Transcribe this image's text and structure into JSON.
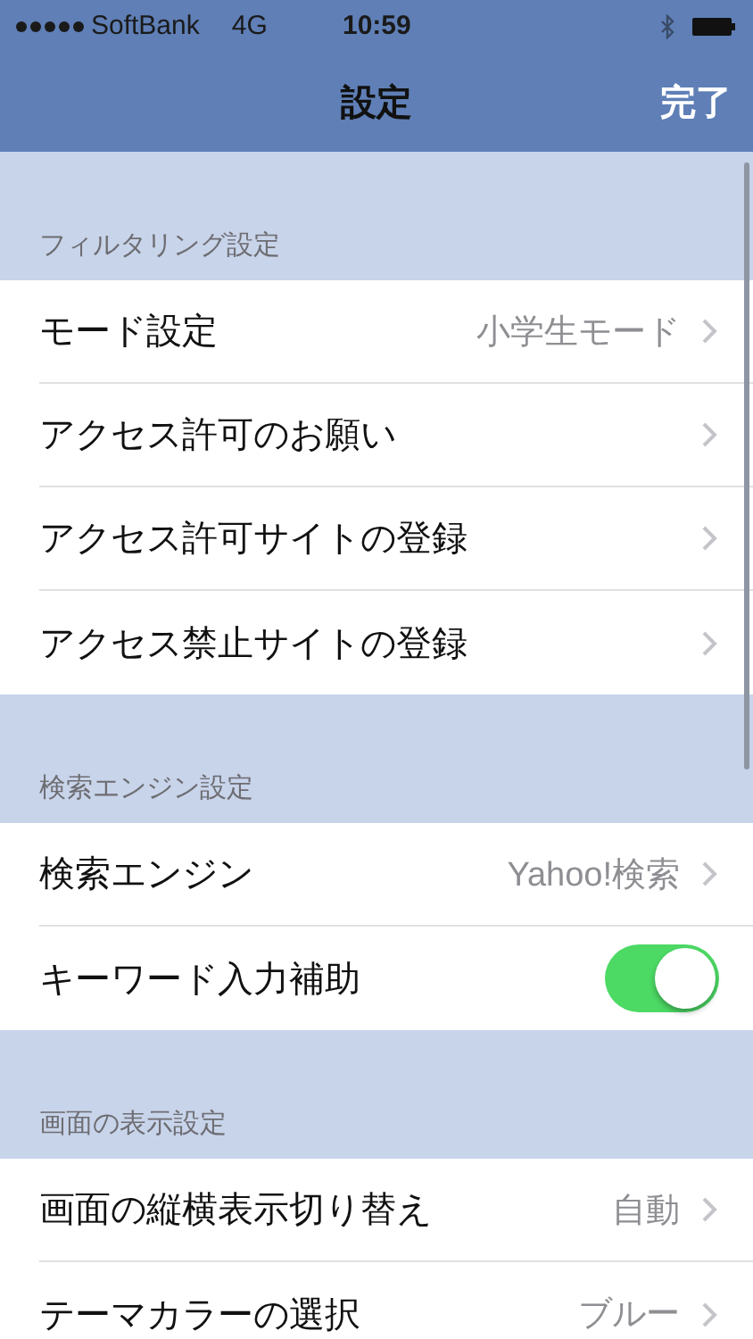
{
  "status_bar": {
    "carrier": "SoftBank",
    "network": "4G",
    "time": "10:59"
  },
  "nav_bar": {
    "title": "設定",
    "done": "完了"
  },
  "sections": [
    {
      "header": "フィルタリング設定",
      "rows": [
        {
          "kind": "link",
          "label": "モード設定",
          "value": "小学生モード"
        },
        {
          "kind": "link",
          "label": "アクセス許可のお願い"
        },
        {
          "kind": "link",
          "label": "アクセス許可サイトの登録"
        },
        {
          "kind": "link",
          "label": "アクセス禁止サイトの登録"
        }
      ]
    },
    {
      "header": "検索エンジン設定",
      "rows": [
        {
          "kind": "link",
          "label": "検索エンジン",
          "value": "Yahoo!検索"
        },
        {
          "kind": "toggle",
          "label": "キーワード入力補助",
          "on": true
        }
      ]
    },
    {
      "header": "画面の表示設定",
      "rows": [
        {
          "kind": "link",
          "label": "画面の縦横表示切り替え",
          "value": "自動"
        },
        {
          "kind": "link",
          "label": "テーマカラーの選択",
          "value": "ブルー"
        }
      ]
    }
  ]
}
